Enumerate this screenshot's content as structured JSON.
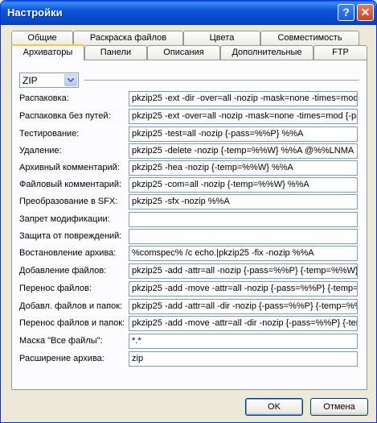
{
  "window": {
    "title": "Настройки",
    "help": "?",
    "close": "✕"
  },
  "tabs_row1": [
    "Общие",
    "Раскраска файлов",
    "Цвета",
    "Совместимость"
  ],
  "tabs_row2": [
    "Архиваторы",
    "Панели",
    "Описания",
    "Дополнительные",
    "FTP"
  ],
  "archiver_select": {
    "value": "ZIP"
  },
  "rows": [
    {
      "label": "Распаковка:",
      "value": "pkzip25 -ext -dir -over=all -nozip -mask=none -times=mod {-"
    },
    {
      "label": "Распаковка без путей:",
      "value": "pkzip25 -ext -over=all -nozip -mask=none -times=mod {-pas"
    },
    {
      "label": "Тестирование:",
      "value": "pkzip25 -test=all -nozip {-pass=%%P} %%A"
    },
    {
      "label": "Удаление:",
      "value": "pkzip25 -delete -nozip {-temp=%%W} %%A @%%LNMA"
    },
    {
      "label": "Архивный комментарий:",
      "value": "pkzip25 -hea -nozip {-temp=%%W} %%A"
    },
    {
      "label": "Файловый комментарий:",
      "value": "pkzip25 -com=all -nozip {-temp=%%W} %%A"
    },
    {
      "label": "Преобразование в SFX:",
      "value": "pkzip25 -sfx -nozip %%A"
    },
    {
      "label": "Запрет модификации:",
      "value": ""
    },
    {
      "label": "Защита от повреждений:",
      "value": ""
    },
    {
      "label": "Востановление архива:",
      "value": "%comspec% /c echo.|pkzip25 -fix -nozip %%A"
    },
    {
      "label": "Добавление файлов:",
      "value": "pkzip25 -add -attr=all -nozip {-pass=%%P} {-temp=%%W} %"
    },
    {
      "label": "Перенос файлов:",
      "value": "pkzip25 -add -move -attr=all -nozip {-pass=%%P} {-temp=%"
    },
    {
      "label": "Добавл. файлов и папок:",
      "value": "pkzip25 -add -attr=all -dir -nozip {-pass=%%P} {-temp=%%W"
    },
    {
      "label": "Перенос файлов и папок:",
      "value": "pkzip25 -add -move -attr=all -dir -nozip {-pass=%%P} {-temp"
    },
    {
      "label": "Маска \"Все файлы\":",
      "value": "*.*"
    },
    {
      "label": "Расширение архива:",
      "value": "zip"
    }
  ],
  "buttons": {
    "ok": "OK",
    "cancel": "Отмена"
  }
}
